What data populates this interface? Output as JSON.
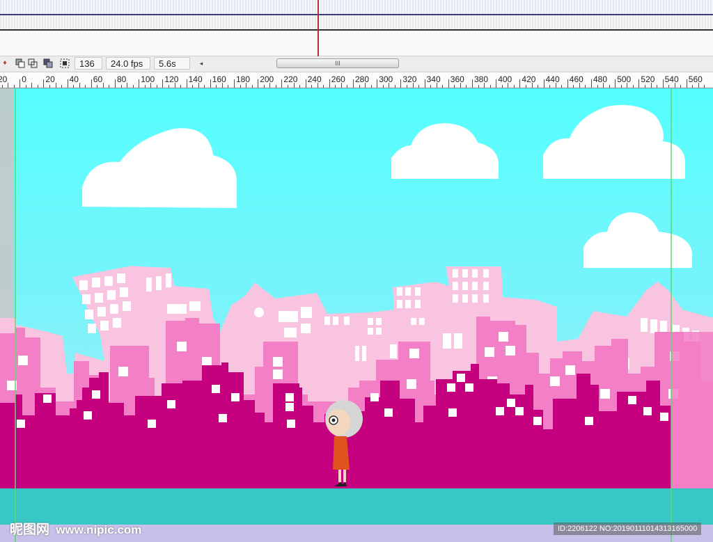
{
  "status_bar": {
    "frame_number": "136",
    "frame_rate": "24.0 fps",
    "elapsed_time": "5.6s",
    "scroll_thumb_grip": "III",
    "scroll_left_arrow": "◂"
  },
  "ruler": {
    "labels": [
      "20",
      "0",
      "20",
      "40",
      "60",
      "80",
      "100",
      "120",
      "140",
      "160",
      "180",
      "200",
      "220",
      "240",
      "260",
      "280",
      "300",
      "320",
      "340",
      "360",
      "380",
      "400",
      "420",
      "440",
      "460",
      "480",
      "500",
      "520",
      "540",
      "560"
    ]
  },
  "watermark": {
    "brand": "昵图网",
    "site": "www.nipic.com",
    "id_text": "ID:2206122 NO:20190111014313165000"
  },
  "colors": {
    "sky_top": "#55ffff",
    "sky_bottom": "#a9ecf5",
    "pale_pink": "#f8c4e0",
    "mid_pink": "#f37fc6",
    "magenta": "#c4007e",
    "ground": "#37c7c5",
    "lower_band": "#c6c0ea",
    "guide_green": "#5cd96b",
    "playhead": "#b0302f"
  },
  "icons": [
    "onion-skin-icon",
    "onion-outline-icon",
    "edit-multiple-icon",
    "onion-markers-icon",
    "center-frame-icon"
  ]
}
